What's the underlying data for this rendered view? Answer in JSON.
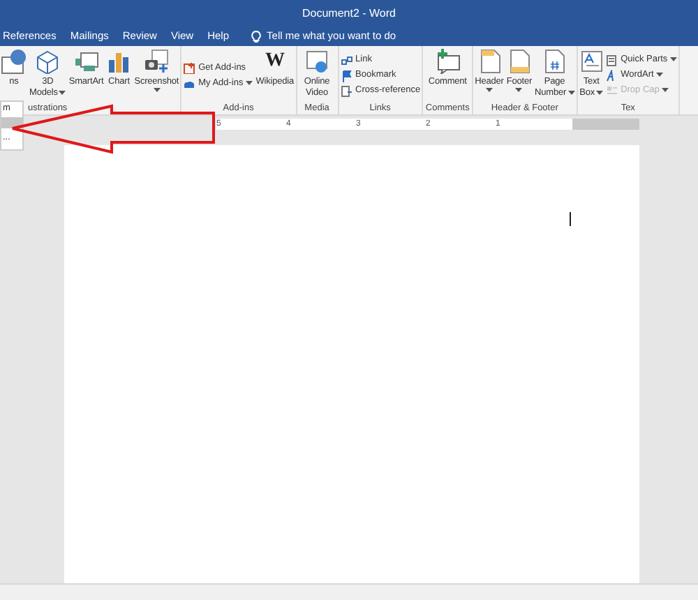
{
  "window": {
    "title": "Document2 - Word"
  },
  "tabs": [
    {
      "label": "References",
      "selected": false
    },
    {
      "label": "Mailings",
      "selected": false
    },
    {
      "label": "Review",
      "selected": false
    },
    {
      "label": "View",
      "selected": false
    },
    {
      "label": "Help",
      "selected": false
    }
  ],
  "tell_me": {
    "text": "Tell me what you want to do"
  },
  "ribbon": {
    "groups": [
      {
        "label": "ustrations",
        "items": [
          {
            "kind": "large",
            "lines": [
              "ns"
            ],
            "dropdown": false
          },
          {
            "kind": "large",
            "lines": [
              "3D",
              "Models"
            ],
            "dropdown": true
          },
          {
            "kind": "large",
            "lines": [
              "SmartArt"
            ],
            "dropdown": false
          },
          {
            "kind": "large",
            "lines": [
              "Chart"
            ],
            "dropdown": false
          },
          {
            "kind": "large",
            "lines": [
              "Screenshot"
            ],
            "dropdown": true
          }
        ]
      },
      {
        "label": "Add-ins",
        "items": [
          {
            "kind": "stack",
            "items": [
              {
                "label": "Get Add-ins",
                "dropdown": false,
                "disabled": false
              },
              {
                "label": "My Add-ins",
                "dropdown": true,
                "disabled": false
              }
            ]
          },
          {
            "kind": "large",
            "lines": [
              "Wikipedia"
            ],
            "glyph": "W",
            "dropdown": false
          }
        ]
      },
      {
        "label": "Media",
        "items": [
          {
            "kind": "large",
            "lines": [
              "Online",
              "Video"
            ],
            "dropdown": false
          }
        ]
      },
      {
        "label": "Links",
        "items": [
          {
            "kind": "stack",
            "items": [
              {
                "label": "Link",
                "dropdown": false,
                "disabled": false
              },
              {
                "label": "Bookmark",
                "dropdown": false,
                "disabled": false
              },
              {
                "label": "Cross-reference",
                "dropdown": false,
                "disabled": false
              }
            ]
          }
        ]
      },
      {
        "label": "Comments",
        "items": [
          {
            "kind": "large",
            "lines": [
              "Comment"
            ],
            "dropdown": false
          }
        ]
      },
      {
        "label": "Header & Footer",
        "items": [
          {
            "kind": "large",
            "lines": [
              "Header"
            ],
            "dropdown": true
          },
          {
            "kind": "large",
            "lines": [
              "Footer"
            ],
            "dropdown": true
          },
          {
            "kind": "large",
            "lines": [
              "Page",
              "Number"
            ],
            "dropdown": true
          }
        ]
      },
      {
        "label": "Tex",
        "items": [
          {
            "kind": "large",
            "lines": [
              "Text",
              "Box"
            ],
            "dropdown": true
          },
          {
            "kind": "stack",
            "items": [
              {
                "label": "Quick Parts",
                "dropdown": true,
                "disabled": false
              },
              {
                "label": "WordArt",
                "dropdown": true,
                "disabled": false
              },
              {
                "label": "Drop Cap",
                "dropdown": true,
                "disabled": true
              }
            ]
          }
        ]
      }
    ]
  },
  "ruler": {
    "numbers": [
      "5",
      "4",
      "3",
      "2",
      "1"
    ]
  },
  "side_menu": {
    "items": [
      "m",
      "..."
    ]
  }
}
